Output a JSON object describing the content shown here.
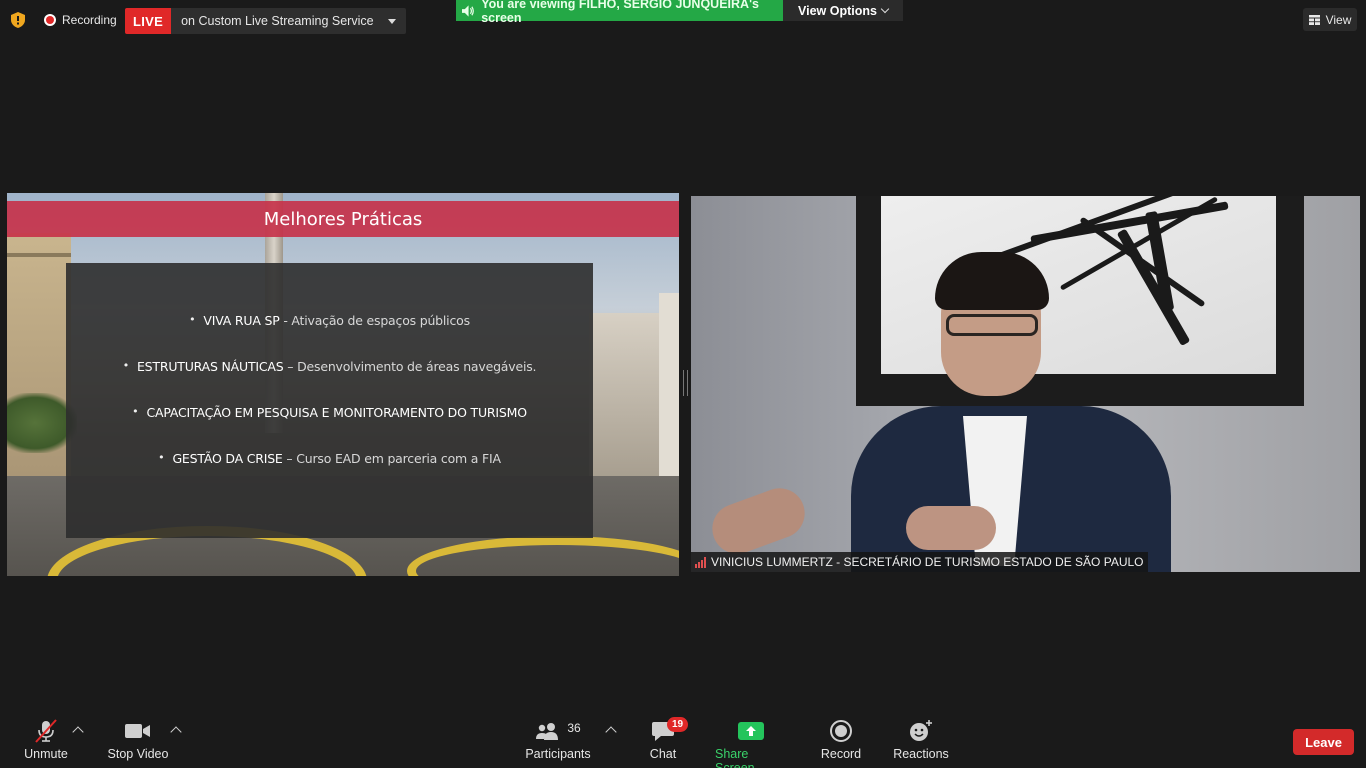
{
  "top_bar": {
    "recording_label": "Recording",
    "live_badge": "LIVE",
    "live_service": "on Custom Live Streaming Service",
    "viewing_text": "You are viewing FILHO, SERGIO JUNQUEIRA's screen",
    "view_options_label": "View Options",
    "view_label": "View"
  },
  "shared_slide": {
    "title": "Melhores Práticas",
    "bullets": [
      {
        "strong": "VIVA RUA SP",
        "rest": " - Ativação de espaços públicos"
      },
      {
        "strong": "ESTRUTURAS NÁUTICAS",
        "rest": " – Desenvolvimento de áreas navegáveis."
      },
      {
        "strong": "CAPACITAÇÃO EM PESQUISA E MONITORAMENTO DO TURISMO",
        "rest": ""
      },
      {
        "strong": "GESTÃO DA CRISE",
        "rest": " – Curso EAD em parceria com a FIA"
      }
    ]
  },
  "speaker": {
    "name": "VINICIUS LUMMERTZ - SECRETÁRIO DE TURISMO ESTADO DE SÃO PAULO"
  },
  "toolbar": {
    "unmute_label": "Unmute",
    "stop_video_label": "Stop Video",
    "participants_label": "Participants",
    "participants_count": "36",
    "chat_label": "Chat",
    "chat_badge": "19",
    "share_screen_label": "Share Screen",
    "record_label": "Record",
    "reactions_label": "Reactions",
    "leave_label": "Leave"
  },
  "colors": {
    "live_red": "#e02828",
    "viewing_green": "#24a846",
    "share_green": "#24c45c",
    "slide_title_bar": "#c63048",
    "leave_red": "#d32a2a"
  },
  "icons": [
    "security-shield-icon",
    "recording-icon",
    "speaker-icon",
    "view-grid-icon",
    "mic-muted-icon",
    "video-camera-icon",
    "participants-icon",
    "chat-icon",
    "share-screen-icon",
    "record-icon",
    "reactions-icon",
    "signal-bars-icon"
  ]
}
